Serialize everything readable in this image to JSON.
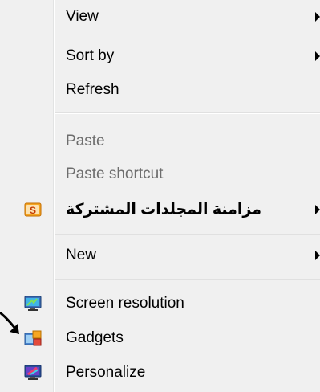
{
  "menu": {
    "items": [
      {
        "label": "View",
        "has_submenu": true,
        "enabled": true
      },
      {
        "label": "Sort by",
        "has_submenu": true,
        "enabled": true
      },
      {
        "label": "Refresh",
        "has_submenu": false,
        "enabled": true
      },
      {
        "label": "Paste",
        "has_submenu": false,
        "enabled": false
      },
      {
        "label": "Paste shortcut",
        "has_submenu": false,
        "enabled": false
      },
      {
        "label": "مزامنة المجلدات المشتركة",
        "has_submenu": true,
        "enabled": true,
        "icon": "shared-folder-sync-icon"
      },
      {
        "label": "New",
        "has_submenu": true,
        "enabled": true
      },
      {
        "label": "Screen resolution",
        "has_submenu": false,
        "enabled": true,
        "icon": "monitor-icon"
      },
      {
        "label": "Gadgets",
        "has_submenu": false,
        "enabled": true,
        "icon": "gadgets-icon"
      },
      {
        "label": "Personalize",
        "has_submenu": false,
        "enabled": true,
        "icon": "personalize-icon"
      }
    ]
  },
  "colors": {
    "menu_background": "#f0f0f0",
    "disabled_text": "#6d6d6d",
    "text": "#000000"
  }
}
